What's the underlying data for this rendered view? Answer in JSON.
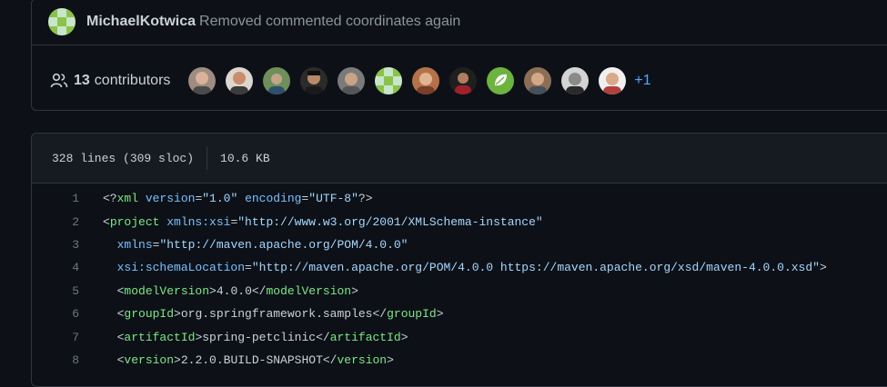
{
  "commit": {
    "author": "MichaelKotwica",
    "message": "Removed commented coordinates again"
  },
  "contributors": {
    "count": "13",
    "label": "contributors",
    "more": "+1",
    "avatars": [
      "contributor-1",
      "contributor-2",
      "contributor-3",
      "contributor-4",
      "contributor-5",
      "contributor-6",
      "contributor-7",
      "contributor-8",
      "contributor-9",
      "contributor-10",
      "contributor-11",
      "contributor-12"
    ]
  },
  "file": {
    "lines_info": "328 lines (309 sloc)",
    "size": "10.6 KB"
  },
  "code": {
    "line_numbers": [
      "1",
      "2",
      "3",
      "4",
      "5",
      "6",
      "7",
      "8"
    ],
    "l1": {
      "open": "<?",
      "name": "xml",
      "a1": " version",
      "eq1": "=",
      "v1": "\"1.0\"",
      "a2": " encoding",
      "eq2": "=",
      "v2": "\"UTF-8\"",
      "close": "?>"
    },
    "l2": {
      "open": "<",
      "name": "project",
      "a1": " xmlns:xsi",
      "eq1": "=",
      "v1": "\"http://www.w3.org/2001/XMLSchema-instance\""
    },
    "l3": {
      "indent": "  ",
      "a1": "xmlns",
      "eq1": "=",
      "v1": "\"http://maven.apache.org/POM/4.0.0\""
    },
    "l4": {
      "indent": "  ",
      "a1": "xsi:schemaLocation",
      "eq1": "=",
      "v1": "\"http://maven.apache.org/POM/4.0.0 https://maven.apache.org/xsd/maven-4.0.0.xsd\"",
      "close": ">"
    },
    "l5": {
      "indent": "  ",
      "tag": "modelVersion",
      "text": "4.0.0"
    },
    "l6": {
      "indent": "  ",
      "tag": "groupId",
      "text": "org.springframework.samples"
    },
    "l7": {
      "indent": "  ",
      "tag": "artifactId",
      "text": "spring-petclinic"
    },
    "l8": {
      "indent": "  ",
      "tag": "version",
      "text": "2.2.0.BUILD-SNAPSHOT"
    }
  },
  "colors": {
    "background": "#0d1117",
    "border": "#30363d",
    "link": "#58a6ff",
    "tag": "#7ee787",
    "attr": "#79c0ff",
    "string": "#a5d6ff"
  }
}
